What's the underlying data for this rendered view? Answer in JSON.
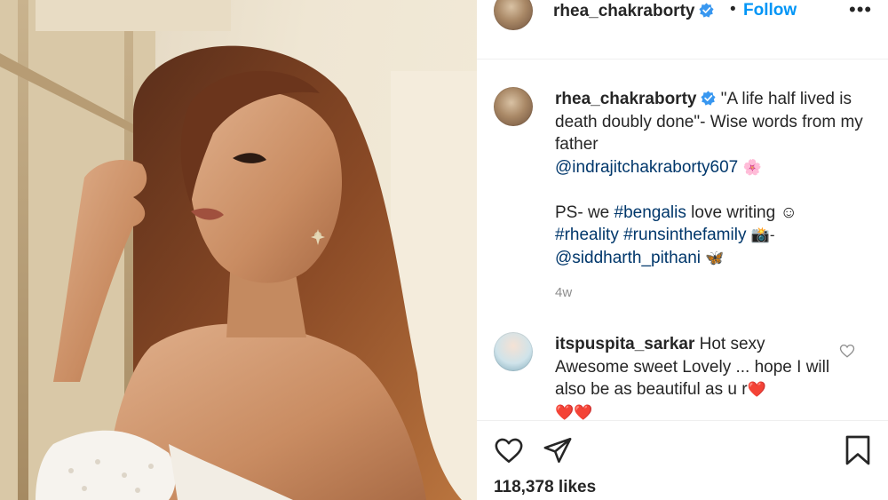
{
  "post": {
    "username": "rhea_chakraborty",
    "verified": true,
    "follow_separator": "•",
    "follow_label": "Follow",
    "more_label": "•••"
  },
  "caption": {
    "username": "rhea_chakraborty",
    "text_line1": "\"A life half lived is death doubly done\"- Wise words from my father",
    "mention1": "@indrajitchakraborty607",
    "emoji1": "🌸",
    "text_line2": "PS- we",
    "hashtag1": "#bengalis",
    "text_line3": "love writing ☺",
    "hashtag2": "#rheality",
    "hashtag3": "#runsinthefamily",
    "emoji2": "📸-",
    "mention2": "@siddharth_pithani",
    "emoji3": "🦋",
    "age": "4w"
  },
  "comment": {
    "username": "itspuspita_sarkar",
    "text": "Hot sexy Awesome sweet Lovely ... hope I will also be as beautiful as u r",
    "emoji_inline": "❤️",
    "emoji_tail": "❤️❤️"
  },
  "actions": {
    "likes": "118,378 likes"
  },
  "colors": {
    "link": "#00376b",
    "follow": "#0095f6",
    "verified": "#3897f0",
    "meta": "#8e8e8e"
  },
  "icons": [
    "verified-icon",
    "more-icon",
    "heart-icon",
    "share-icon",
    "bookmark-icon",
    "comment-heart-icon"
  ]
}
